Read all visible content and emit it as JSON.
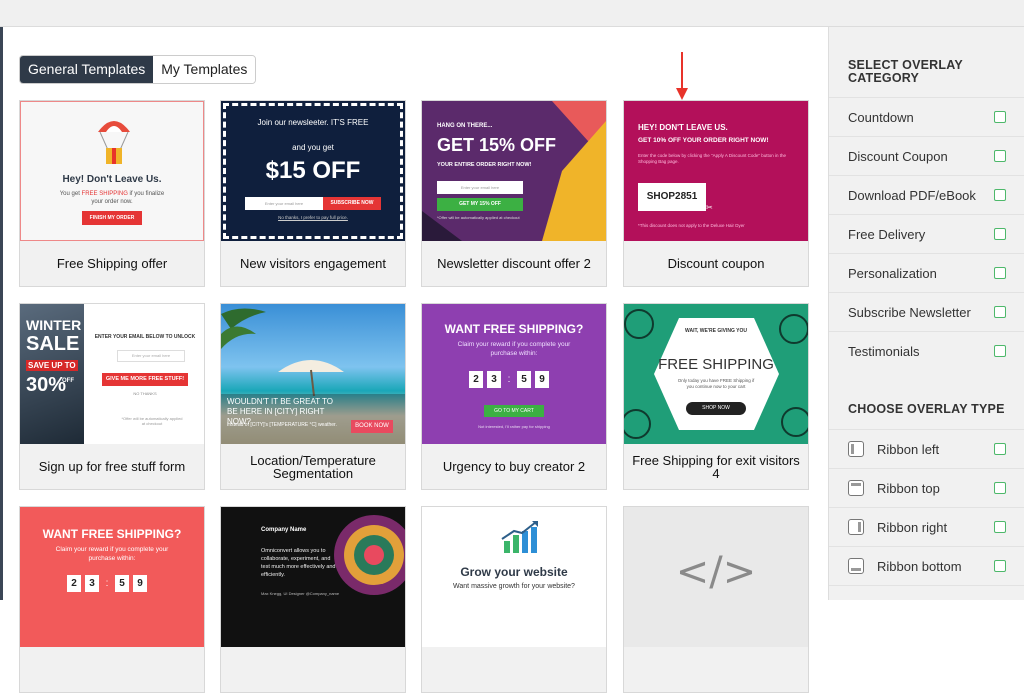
{
  "tabs": {
    "general": "General Templates",
    "mine": "My Templates"
  },
  "templates": [
    {
      "title": "Free Shipping offer",
      "heading": "Hey! Don't Leave Us.",
      "line1": "You get ",
      "highlight": "FREE SHIPPING",
      "line1b": " if you finalize",
      "line2": "your order now.",
      "button": "FINISH MY ORDER"
    },
    {
      "title": "New visitors engagement",
      "heading": "Join our newsleeter. IT'S FREE",
      "sub": "and you get",
      "offer": "$15 OFF",
      "placeholder": "Enter your email here",
      "button": "SUBSCRIBE NOW",
      "note": "No thanks, I prefer to pay full price."
    },
    {
      "title": "Newsletter discount offer 2",
      "kicker": "HANG ON THERE...",
      "offer": "GET 15% OFF",
      "sub": "YOUR ENTIRE ORDER RIGHT NOW!",
      "placeholder": "Enter your email here",
      "button": "GET MY 15% OFF",
      "note": "*Offer will be automatically applied at checkout"
    },
    {
      "title": "Discount coupon",
      "heading": "HEY! DON'T LEAVE US.",
      "sub": "GET 10% OFF YOUR ORDER RIGHT NOW!",
      "body": "Enter the code below by clicking the \"Apply A Discount Code\" button in the Shopping Bag page.",
      "code": "SHOP2851",
      "note": "*This discount does not apply to the Deluxe Hair Dyer"
    },
    {
      "title": "Sign up for free stuff form",
      "big1": "WINTER",
      "big2": "SALE",
      "big3": "SAVE UP TO",
      "pct": "30%",
      "off": "OFF",
      "heading": "ENTER YOUR EMAIL BELOW TO UNLOCK",
      "placeholder": "Enter your email here",
      "button": "GIVE ME MORE FREE STUFF!",
      "decline": "NO THANKS",
      "note": "*Offer will be automatically applied at checkout"
    },
    {
      "title": "Location/Temperature Segmentation",
      "heading": "WOULDN'T IT BE GREAT TO BE HERE IN [CITY] RIGHT NOW?",
      "sub": "Instead of [CITY]'s [TEMPERATURE °C] weather.",
      "button": "BOOK NOW"
    },
    {
      "title": "Urgency to buy creator 2",
      "heading": "WANT FREE SHIPPING?",
      "sub": "Claim your reward if you complete your purchase within:",
      "digits": [
        "2",
        "3",
        "5",
        "9"
      ],
      "button": "GO TO MY CART",
      "note": "Not interested, I'll rather pay for shipping"
    },
    {
      "title": "Free Shipping for exit visitors 4",
      "kicker": "WAIT, WE'RE GIVING YOU",
      "heading": "FREE SHIPPING",
      "sub": "Only today you have FREE Shipping if you continue now to your cart",
      "button": "SHOP NOW"
    },
    {
      "title": "",
      "heading": "WANT FREE SHIPPING?",
      "sub": "Claim your reward if you complete your purchase within:",
      "digits": [
        "2",
        "3",
        "5",
        "9"
      ]
    },
    {
      "title": "",
      "company": "Company Name",
      "body": "Omniconvert allows you to collaborate, experiment, and test much more effectively and efficiently.",
      "author": "Max Knegg, UI Designer @Company_name"
    },
    {
      "title": "",
      "heading": "Grow your website",
      "sub": "Want massive growth for your website?"
    },
    {
      "title": "",
      "glyph": "</>"
    }
  ],
  "sidebar": {
    "category_title": "SELECT OVERLAY CATEGORY",
    "categories": [
      "Countdown",
      "Discount Coupon",
      "Download PDF/eBook",
      "Free Delivery",
      "Personalization",
      "Subscribe Newsletter",
      "Testimonials"
    ],
    "type_title": "CHOOSE OVERLAY TYPE",
    "types": [
      {
        "label": "Ribbon left",
        "icon": "ribbon-left-icon"
      },
      {
        "label": "Ribbon top",
        "icon": "ribbon-top-icon"
      },
      {
        "label": "Ribbon right",
        "icon": "ribbon-right-icon"
      },
      {
        "label": "Ribbon bottom",
        "icon": "ribbon-bottom-icon"
      }
    ]
  },
  "colors": {
    "accent_dark": "#2f3a48",
    "check_green": "#4db86a",
    "arrow_red": "#e8332a"
  }
}
